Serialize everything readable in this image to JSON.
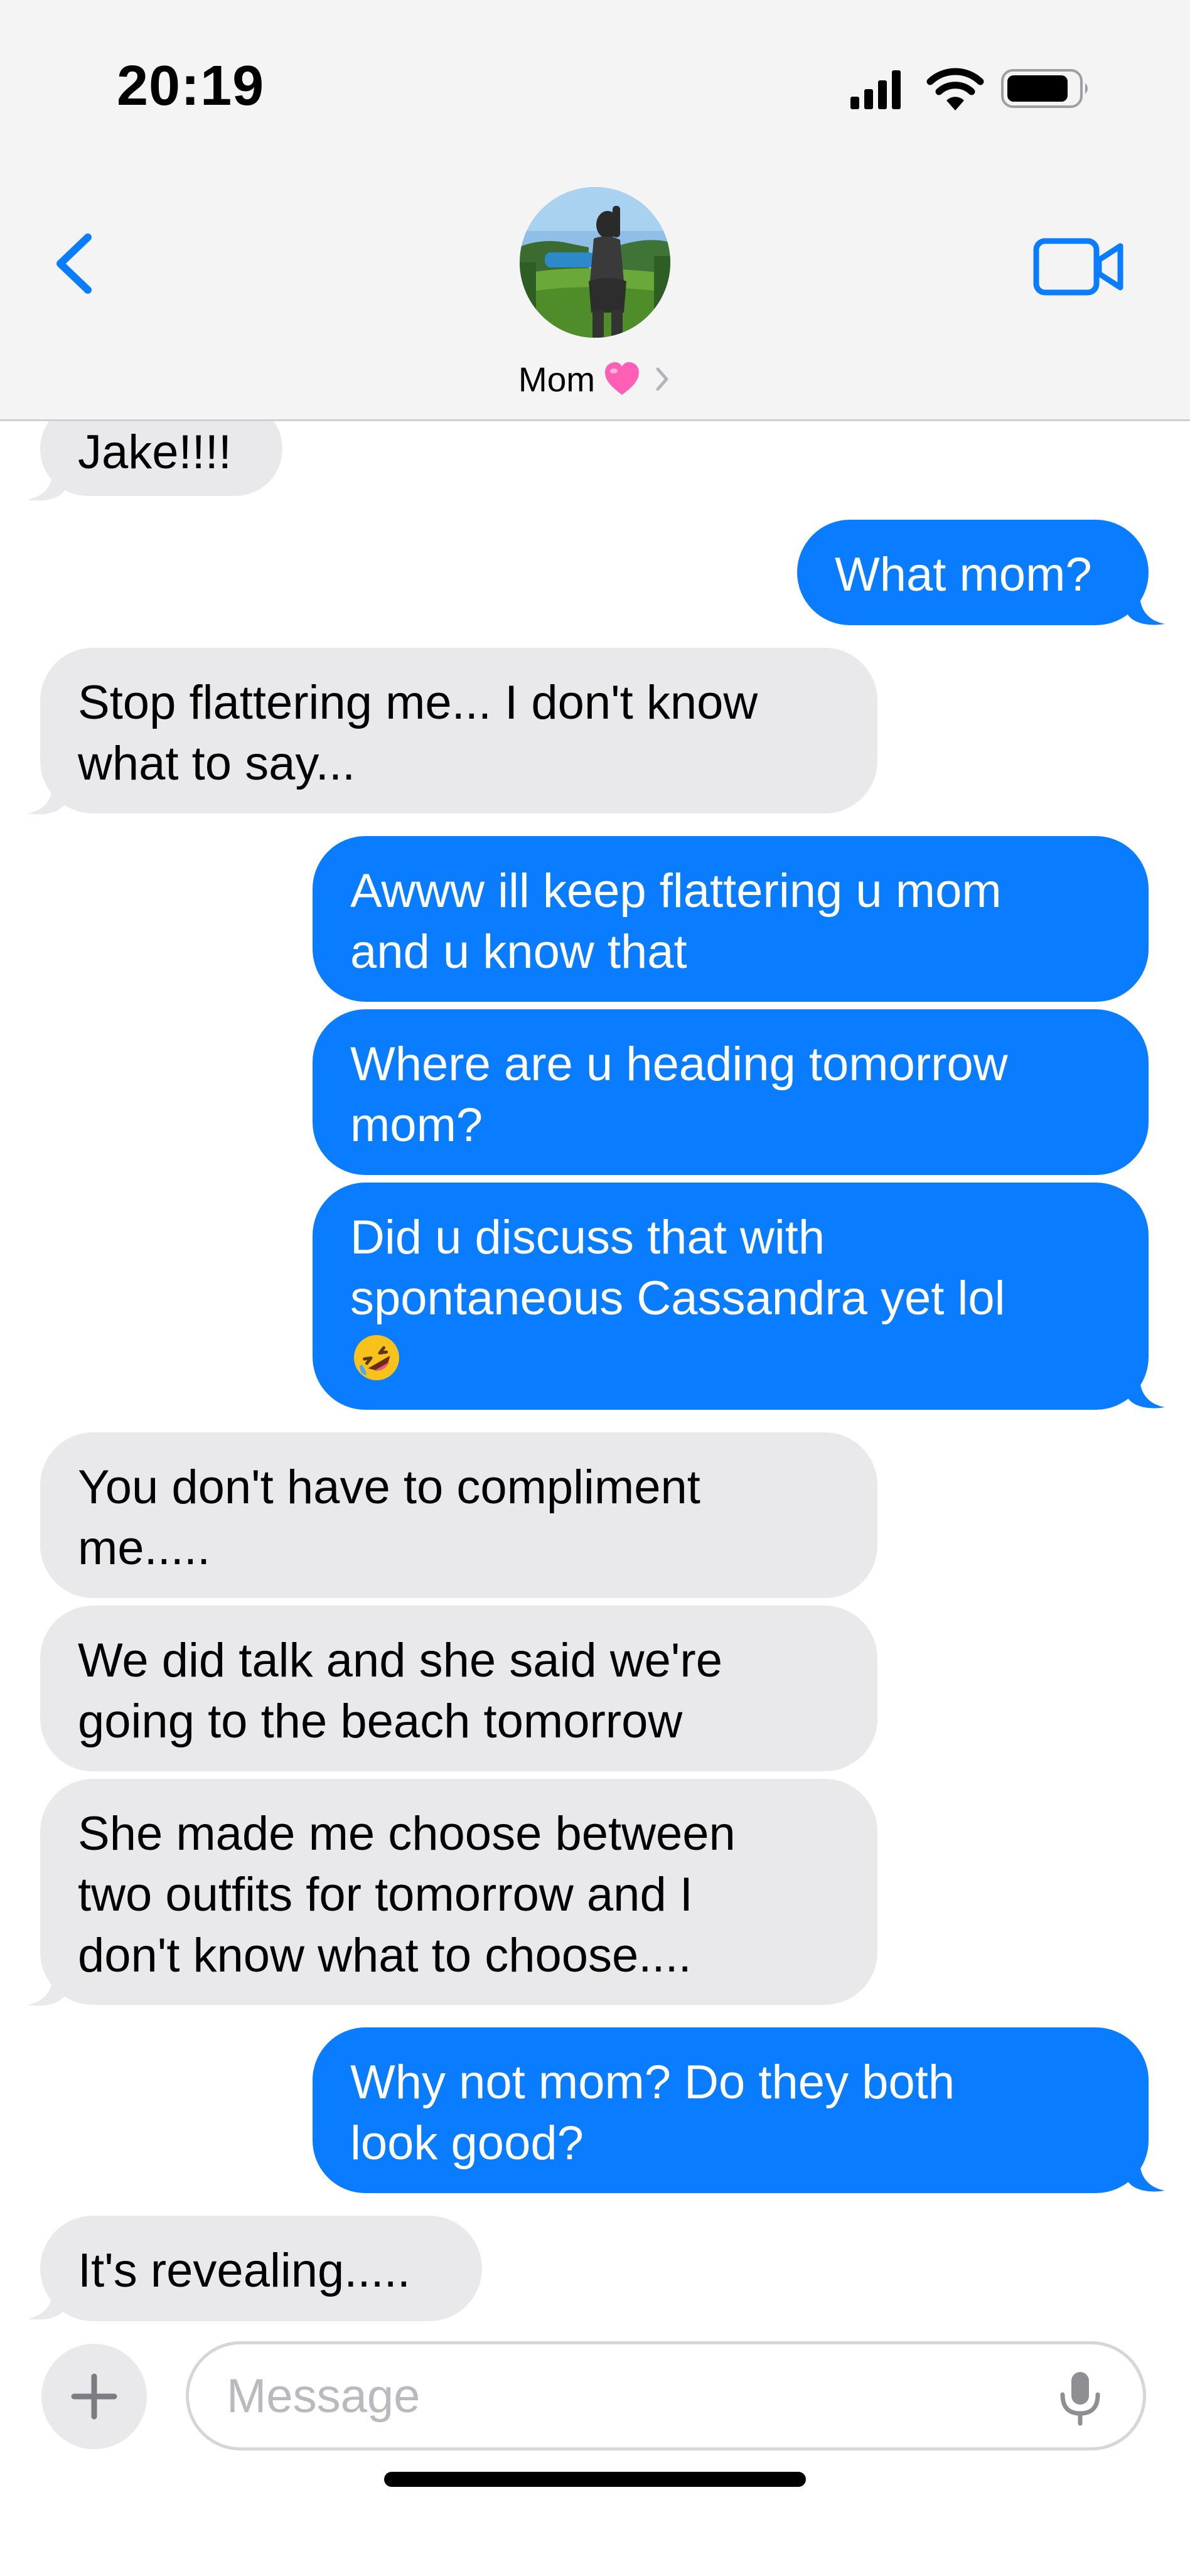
{
  "status_bar": {
    "time": "20:19",
    "icons": [
      "cellular-signal-icon",
      "wifi-icon",
      "battery-icon"
    ]
  },
  "header": {
    "back_icon": "chevron-left-icon",
    "video_icon": "video-camera-icon",
    "contact_name": "Mom",
    "contact_emoji": "pink-heart-icon",
    "details_icon": "chevron-right-icon",
    "accent_color": "#0a7cff"
  },
  "messages": [
    {
      "from": "them",
      "lines": [
        "Jake!!!!"
      ]
    },
    {
      "from": "me",
      "lines": [
        "What mom?"
      ]
    },
    {
      "from": "them",
      "lines": [
        "Stop flattering me... I don't know",
        "what to say..."
      ]
    },
    {
      "from": "me",
      "lines": [
        "Awww ill keep flattering u mom",
        "and u know that"
      ]
    },
    {
      "from": "me",
      "lines": [
        "Where are u heading tomorrow",
        "mom?"
      ]
    },
    {
      "from": "me",
      "lines": [
        "Did u discuss that with",
        "spontaneous Cassandra yet lol"
      ],
      "emoji": "rolling-on-floor-laughing-emoji"
    },
    {
      "from": "them",
      "lines": [
        "You don't have to compliment",
        "me....."
      ]
    },
    {
      "from": "them",
      "lines": [
        "We did talk and she said we're",
        "going to the beach tomorrow"
      ]
    },
    {
      "from": "them",
      "lines": [
        "She made me choose between",
        "two outfits for tomorrow and I",
        "don't know what to choose...."
      ]
    },
    {
      "from": "me",
      "lines": [
        "Why not mom? Do they both",
        "look good?"
      ]
    },
    {
      "from": "them",
      "lines": [
        "It's revealing....."
      ]
    }
  ],
  "colors": {
    "outgoing_bubble": "#0a7cff",
    "incoming_bubble": "#e9e9eb",
    "header_background": "#f4f4f5"
  },
  "composer": {
    "plus_icon": "plus-icon",
    "placeholder": "Message",
    "value": "",
    "mic_icon": "microphone-icon"
  }
}
